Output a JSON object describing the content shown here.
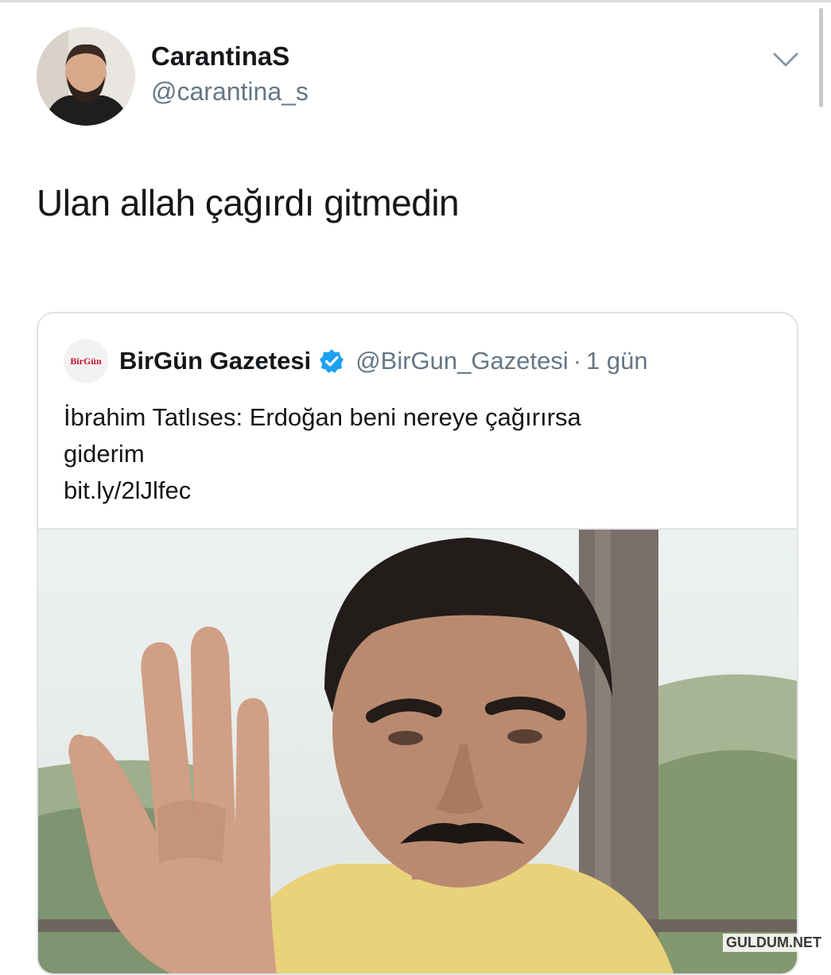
{
  "tweet": {
    "display_name": "CarantinaS",
    "handle": "@carantina_s",
    "text": "Ulan allah çağırdı gitmedin"
  },
  "quoted_tweet": {
    "logo_text": "BirGün",
    "display_name": "BirGün Gazetesi",
    "handle": "@BirGun_Gazetesi",
    "separator": "·",
    "time": "1 gün",
    "text_lines": [
      "İbrahim Tatlıses: Erdoğan beni nereye çağırırsa",
      "giderim"
    ],
    "link": "bit.ly/2lJlfec"
  },
  "watermark": "GULDUM.NET",
  "colors": {
    "text_primary": "#14171a",
    "text_secondary": "#657786",
    "verified_blue": "#1da1f2",
    "border": "#dfe3e6"
  },
  "icons": {
    "menu": "chevron-down-icon",
    "verified": "verified-badge-icon"
  }
}
